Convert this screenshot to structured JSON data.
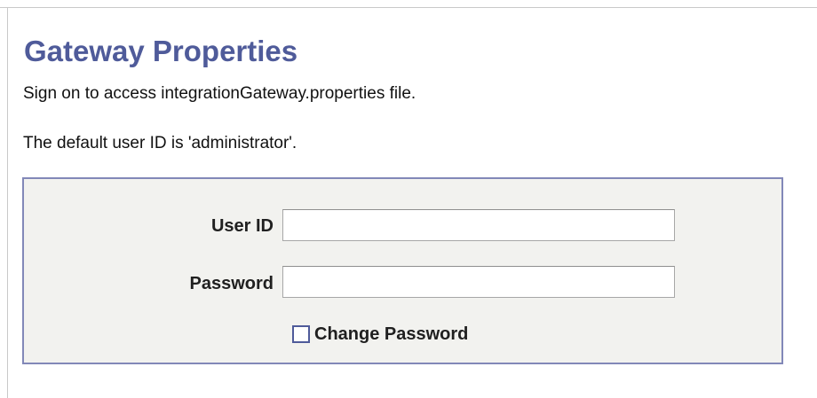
{
  "page": {
    "title": "Gateway Properties",
    "instructions": [
      "Sign on to access integrationGateway.properties file.",
      "The default user ID is 'administrator'."
    ]
  },
  "signon_form": {
    "user_id": {
      "label": "User ID",
      "value": ""
    },
    "password": {
      "label": "Password",
      "value": ""
    },
    "change_password": {
      "label": "Change Password",
      "checked": false
    }
  },
  "colors": {
    "title": "#4f5b9a",
    "panel_border": "#8288b8",
    "panel_background": "#f2f2ef",
    "checkbox_border": "#4f5b9a"
  }
}
